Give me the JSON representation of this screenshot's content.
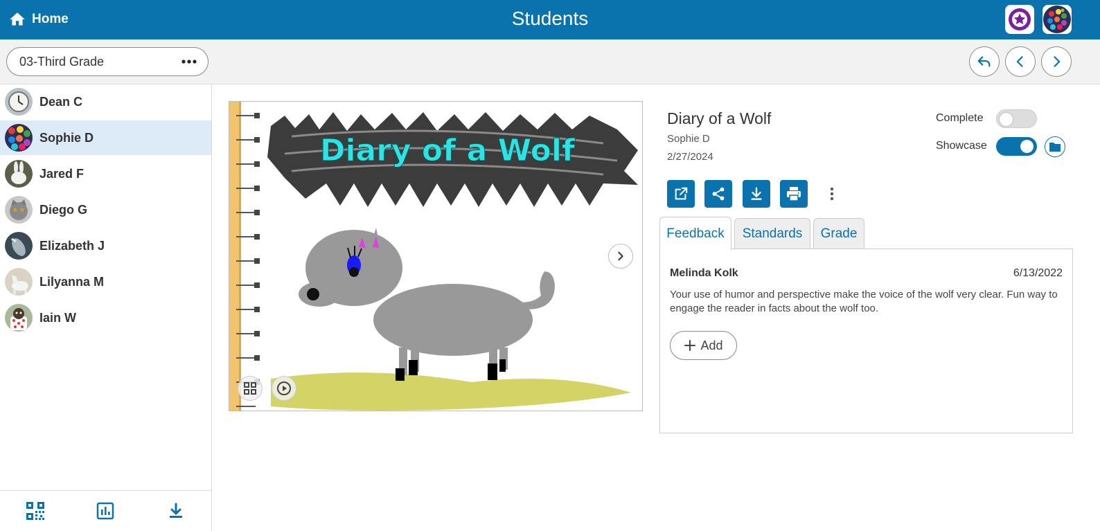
{
  "header": {
    "home_label": "Home",
    "title": "Students",
    "accent_color": "#0a72ad"
  },
  "class_selector": {
    "value": "03-Third Grade"
  },
  "students": [
    {
      "name": "Dean C",
      "avatar": "clock"
    },
    {
      "name": "Sophie D",
      "avatar": "colorful-dots",
      "selected": true
    },
    {
      "name": "Jared F",
      "avatar": "rabbit"
    },
    {
      "name": "Diego G",
      "avatar": "cat"
    },
    {
      "name": "Elizabeth J",
      "avatar": "dolphin"
    },
    {
      "name": "Lilyanna M",
      "avatar": "horse"
    },
    {
      "name": "Iain W",
      "avatar": "puppy-in-cup"
    }
  ],
  "artwork": {
    "title_text": "Diary of a Wolf"
  },
  "details": {
    "title": "Diary of a Wolf",
    "author": "Sophie D",
    "date": "2/27/2024",
    "complete_label": "Complete",
    "complete": false,
    "showcase_label": "Showcase",
    "showcase": true
  },
  "actions": [
    "open-external-icon",
    "share-icon",
    "download-icon",
    "print-icon",
    "more-vertical-icon"
  ],
  "tabs": [
    {
      "label": "Feedback",
      "active": true
    },
    {
      "label": "Standards",
      "active": false
    },
    {
      "label": "Grade",
      "active": false
    }
  ],
  "feedback": {
    "author": "Melinda Kolk",
    "date": "6/13/2022",
    "text": "Your use of humor and perspective make the voice of the wolf very clear. Fun way to engage the reader in facts about the wolf too.",
    "add_label": "Add"
  },
  "sidebar_footer": [
    "qr-code-icon",
    "bar-chart-icon",
    "download-icon"
  ]
}
